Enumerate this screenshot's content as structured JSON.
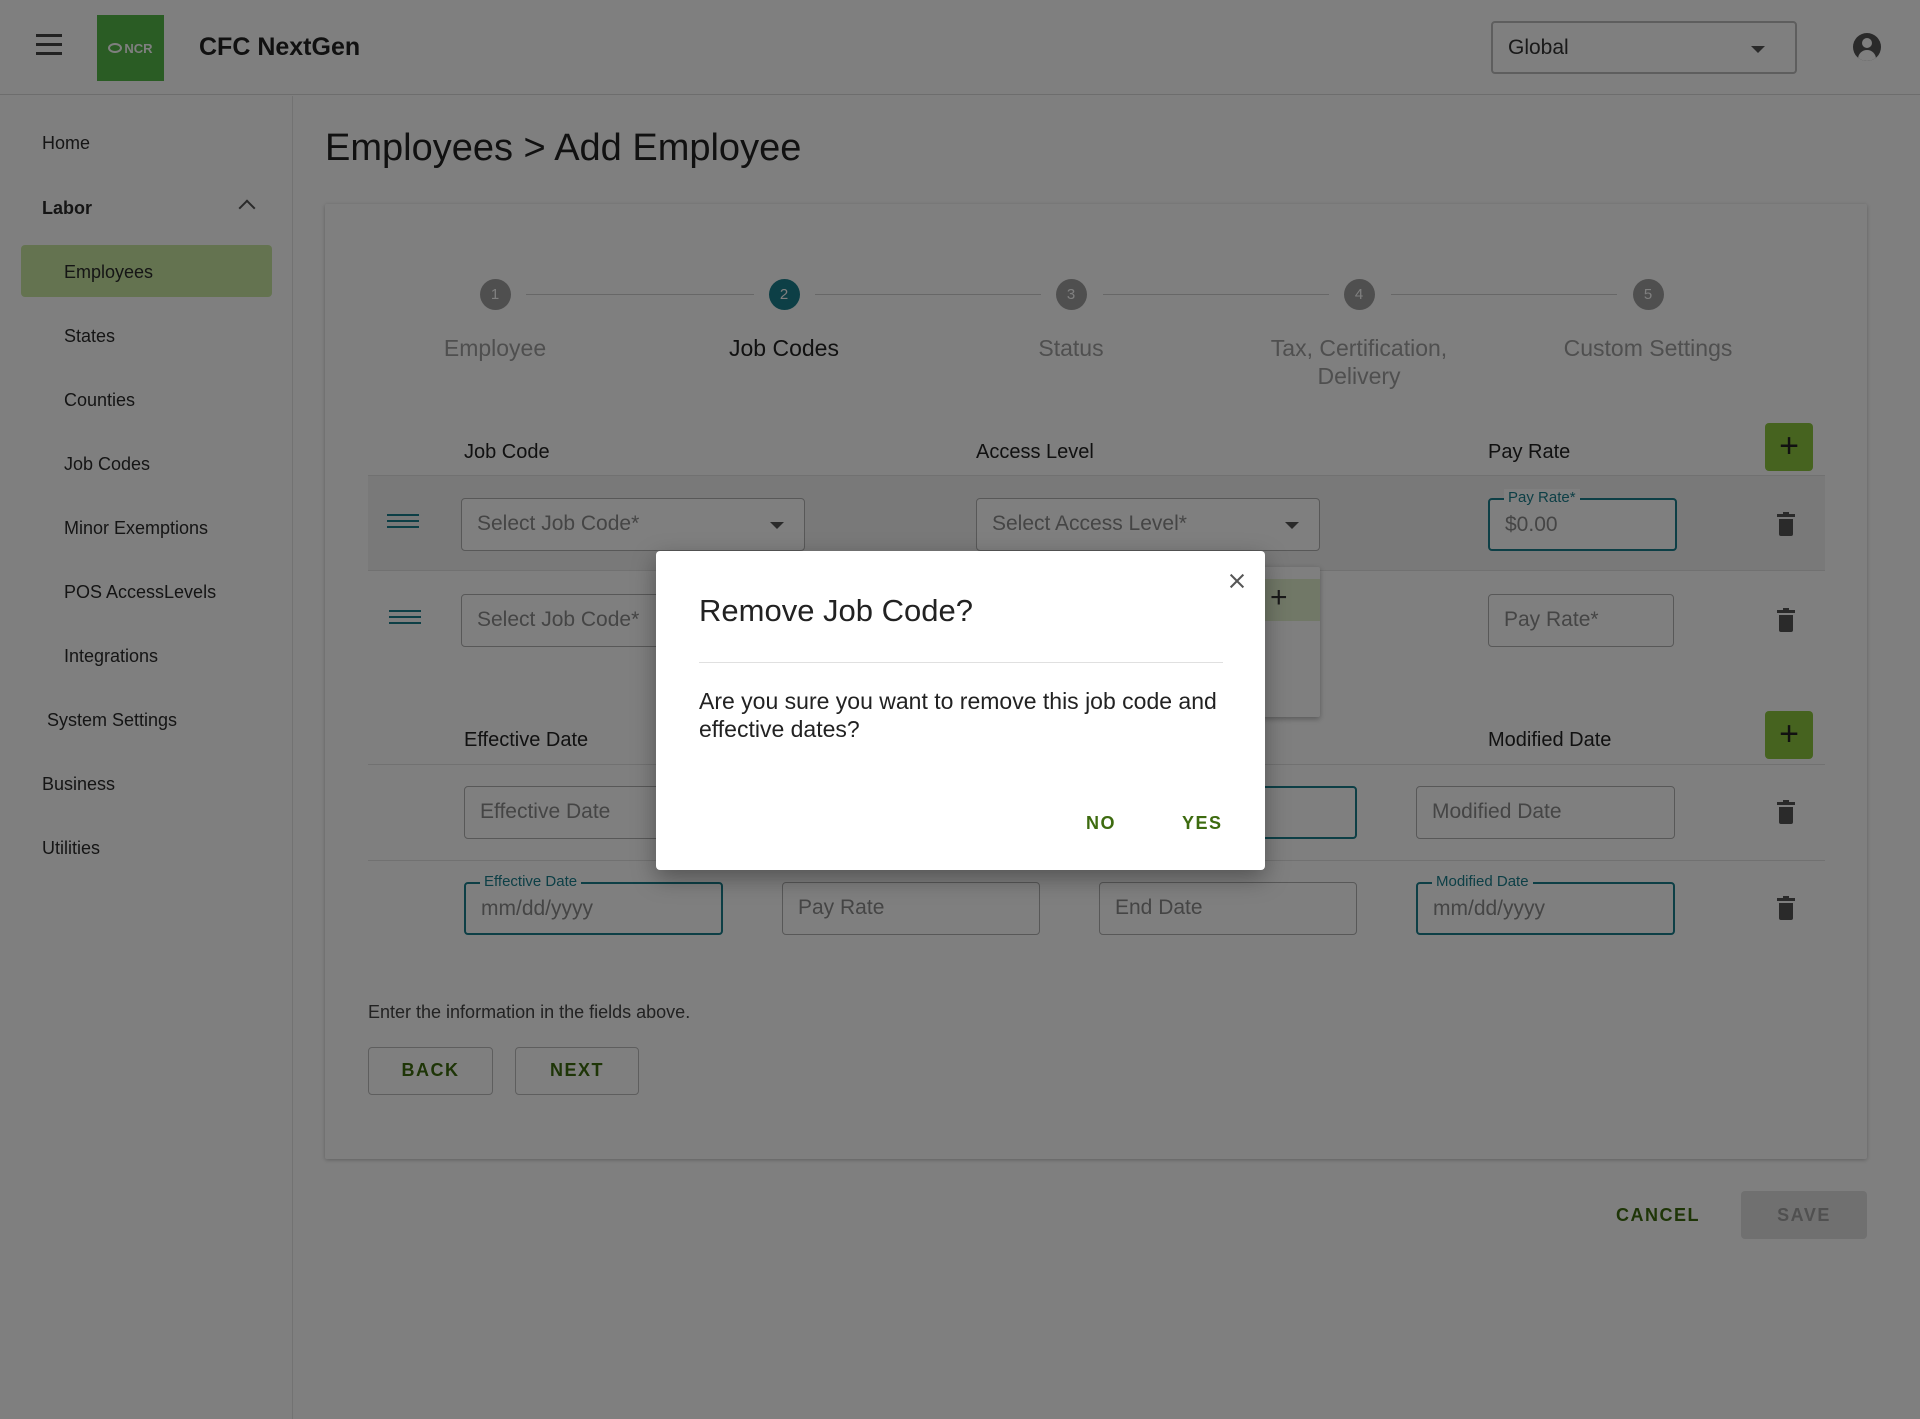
{
  "header": {
    "logo_text": "NCR",
    "app_title": "CFC NextGen",
    "scope_value": "Global"
  },
  "sidebar": {
    "home": "Home",
    "labor": "Labor",
    "labor_items": [
      "Employees",
      "States",
      "Counties",
      "Job Codes",
      "Minor Exemptions",
      "POS AccessLevels",
      "Integrations"
    ],
    "system_settings": "System Settings",
    "business": "Business",
    "utilities": "Utilities",
    "active_item": "Employees"
  },
  "page": {
    "title": "Employees > Add Employee"
  },
  "stepper": {
    "steps": [
      {
        "num": "1",
        "label": "Employee",
        "active": false
      },
      {
        "num": "2",
        "label": "Job Codes",
        "active": true
      },
      {
        "num": "3",
        "label": "Status",
        "active": false
      },
      {
        "num": "4",
        "label_line1": "Tax, Certification,",
        "label_line2": "Delivery",
        "active": false
      },
      {
        "num": "5",
        "label": "Custom Settings",
        "active": false
      }
    ]
  },
  "job_codes": {
    "headers": {
      "job_code": "Job Code",
      "access_level": "Access Level",
      "pay_rate": "Pay Rate"
    },
    "row1": {
      "job_code_placeholder": "Select Job Code*",
      "access_level_placeholder": "Select Access Level*",
      "pay_rate_label": "Pay Rate*",
      "pay_rate_value": "$0.00"
    },
    "row2": {
      "job_code_placeholder": "Select Job Code*",
      "pay_rate_placeholder": "Pay Rate*"
    }
  },
  "effective_dates": {
    "headers": {
      "effective_date": "Effective Date",
      "modified_date": "Modified Date"
    },
    "row1": {
      "effective_placeholder": "Effective Date",
      "modified_placeholder": "Modified Date"
    },
    "row2": {
      "effective_label": "Effective Date",
      "effective_placeholder": "mm/dd/yyyy",
      "pay_rate_placeholder": "Pay Rate",
      "end_date_placeholder": "End Date",
      "modified_label": "Modified Date",
      "modified_placeholder": "mm/dd/yyyy"
    }
  },
  "footer": {
    "helper_text": "Enter the information in the fields above.",
    "back": "BACK",
    "next": "NEXT",
    "cancel": "CANCEL",
    "save": "SAVE"
  },
  "dialog": {
    "title": "Remove Job Code?",
    "body": "Are you sure you want to remove this job code and effective dates?",
    "no": "NO",
    "yes": "YES"
  },
  "colors": {
    "brand_green": "#54b948",
    "accent_teal": "#1a7e8c",
    "add_button": "#8cc63f",
    "active_nav": "#c8e6a0",
    "action_text": "#3d6b0f"
  },
  "icons": [
    "menu-icon",
    "account-icon",
    "chevron-up-icon",
    "drag-handle-icon",
    "trash-icon",
    "plus-icon",
    "close-icon",
    "dropdown-caret-icon"
  ]
}
